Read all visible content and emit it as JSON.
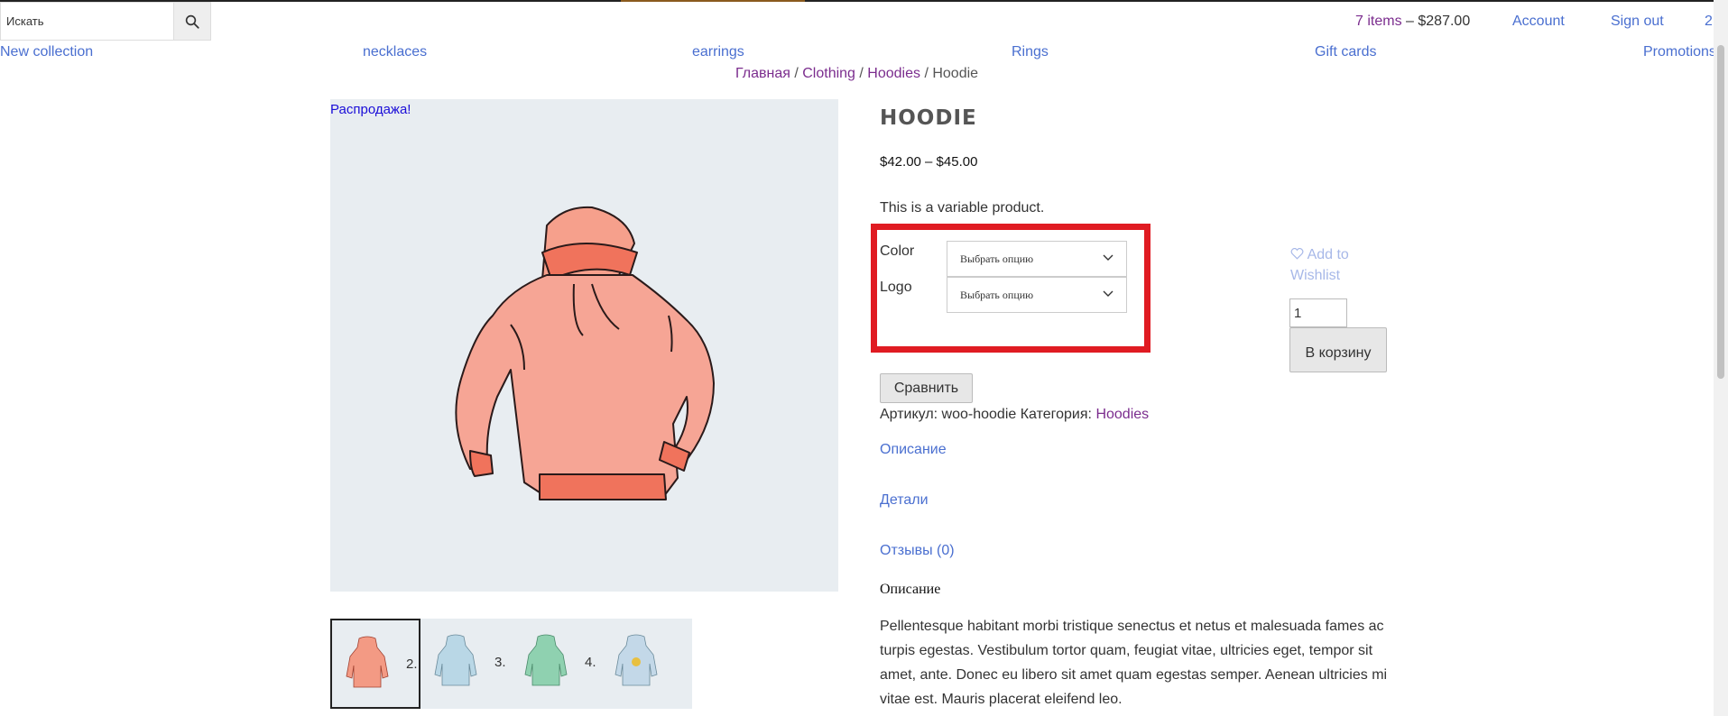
{
  "search": {
    "placeholder": "Искать",
    "icon": "search-icon"
  },
  "header": {
    "cart_items": "7 items",
    "cart_sep": " – ",
    "cart_amount": "$287.00",
    "account": "Account",
    "sign_out": "Sign out",
    "extra": "2"
  },
  "nav": [
    "New collection",
    "necklaces",
    "earrings",
    "Rings",
    "Gift cards",
    "Promotions"
  ],
  "breadcrumb": {
    "home": "Главная",
    "cat": "Clothing",
    "sub": "Hoodies",
    "current": "Hoodie",
    "sep": " / "
  },
  "product": {
    "sale_badge": "Распродажа!",
    "title": "HOODIE",
    "price": "$42.00 – $45.00",
    "short_desc": "This is a variable product.",
    "variations": [
      {
        "label": "Color",
        "select": "Выбрать опцию"
      },
      {
        "label": "Logo",
        "select": "Выбрать опцию"
      }
    ],
    "wishlist": "Add to Wishlist",
    "qty": "1",
    "add_to_cart": "В корзину",
    "compare": "Сравнить",
    "sku_label": "Артикул:",
    "sku": "woo-hoodie",
    "cat_label": "Категория:",
    "cat": "Hoodies"
  },
  "thumbs": [
    {
      "num": "",
      "color": "#f39a84"
    },
    {
      "num": "2.",
      "color": "#b9d7e6"
    },
    {
      "num": "3.",
      "color": "#8fd1b0"
    },
    {
      "num": "4.",
      "color": "#c3d8e8"
    }
  ],
  "tabs": [
    "Описание",
    "Детали",
    "Отзывы (0)"
  ],
  "description": {
    "heading": "Описание",
    "text": "Pellentesque habitant morbi tristique senectus et netus et malesuada fames ac turpis egestas. Vestibulum tortor quam, feugiat vitae, ultricies eget, tempor sit amet, ante. Donec eu libero sit amet quam egestas semper. Aenean ultricies mi vitae est. Mauris placerat eleifend leo."
  },
  "colors": {
    "link": "#4a6fd0",
    "visited": "#7b2d8e",
    "highlight": "#e01b22",
    "gallery_bg": "#e8edf1"
  }
}
